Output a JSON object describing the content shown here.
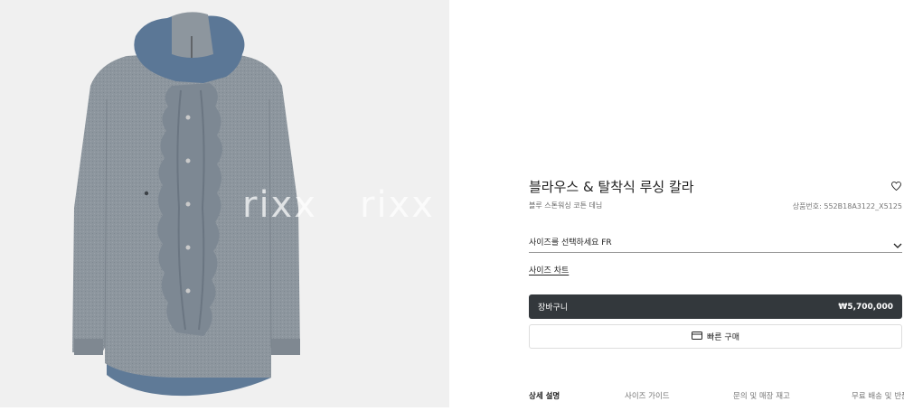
{
  "product": {
    "title": "블라우스 & 탈착식 루싱 칼라",
    "subtitle": "블루 스톤워싱 코튼 데님",
    "reference": "상품번호: 552B18A3122_X5125"
  },
  "watermark": {
    "text": "rixx"
  },
  "size": {
    "label": "사이즈를 선택하세요 FR",
    "chart_link": "사이즈 차트"
  },
  "cart": {
    "label": "장바구니",
    "price": "₩5,700,000"
  },
  "quick_buy": {
    "label": "빠른 구매",
    "icon": "card-icon"
  },
  "tabs": [
    {
      "label": "상세 설명",
      "active": true
    },
    {
      "label": "사이즈 가이드",
      "active": false
    },
    {
      "label": "문의 및 매장 재고",
      "active": false
    },
    {
      "label": "무료 배송 및 반품",
      "active": false
    }
  ],
  "colors": {
    "image_bg": "#f0f0f0",
    "cart_button": "#33383c",
    "shirt_body": "#8b949c",
    "denim": "#5f7a97"
  }
}
